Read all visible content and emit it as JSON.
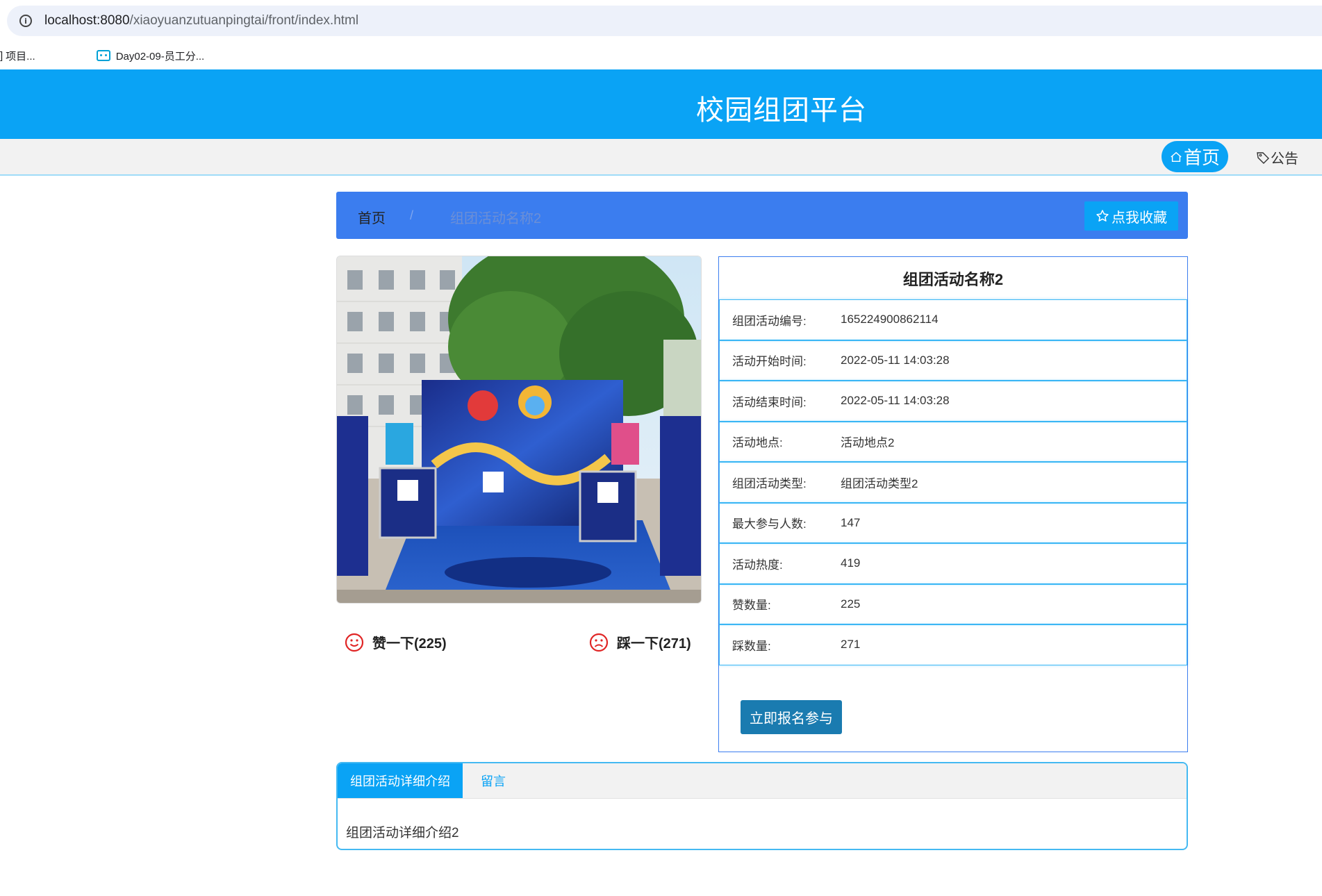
{
  "browser": {
    "url_host": "localhost:8080",
    "url_path": "/xiaoyuanzutuanpingtai/front/index.html",
    "bookmarks": [
      {
        "label": "项目..."
      },
      {
        "label": "Day02-09-员工分..."
      }
    ]
  },
  "header": {
    "site_title": "校园组团平台"
  },
  "nav": {
    "home_label": "首页",
    "notice_label": "公告"
  },
  "breadcrumb": {
    "home": "首页",
    "separator": "/",
    "current": "组团活动名称2"
  },
  "favorite_button": "点我收藏",
  "votes": {
    "up_label": "赞一下(225)",
    "down_label": "踩一下(271)"
  },
  "detail": {
    "title": "组团活动名称2",
    "rows": [
      {
        "label": "组团活动编号:",
        "value": "165224900862114"
      },
      {
        "label": "活动开始时间:",
        "value": "2022-05-11 14:03:28"
      },
      {
        "label": "活动结束时间:",
        "value": "2022-05-11 14:03:28"
      },
      {
        "label": "活动地点:",
        "value": "活动地点2"
      },
      {
        "label": "组团活动类型:",
        "value": "组团活动类型2"
      },
      {
        "label": "最大参与人数:",
        "value": "147"
      },
      {
        "label": "活动热度:",
        "value": "419"
      },
      {
        "label": "赞数量:",
        "value": "225"
      },
      {
        "label": "踩数量:",
        "value": "271"
      }
    ],
    "signup_button": "立即报名参与"
  },
  "tabs": {
    "items": [
      {
        "label": "组团活动详细介绍"
      },
      {
        "label": "留言"
      }
    ],
    "content": "组团活动详细介绍2"
  },
  "colors": {
    "brand": "#0aa3f5",
    "breadcrumb_bg": "#3b7def",
    "signup": "#1a7bb0"
  }
}
